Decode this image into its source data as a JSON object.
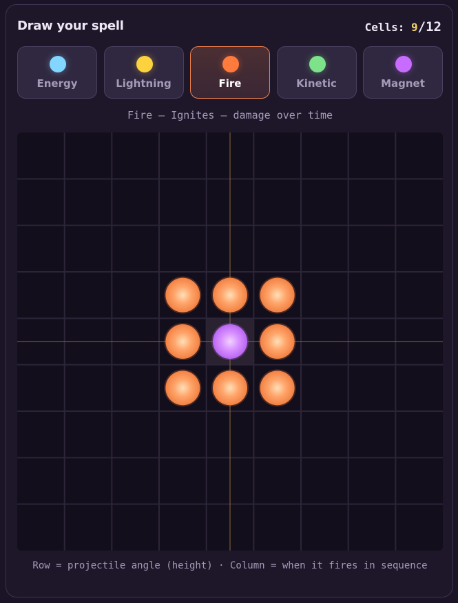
{
  "header": {
    "title": "Draw your spell",
    "cells_label": "Cells:",
    "cells_used": "9",
    "cells_max": "12",
    "cells_sep": "/"
  },
  "elements": [
    {
      "label": "Energy",
      "color": "#82d6ff",
      "icon": "energy-orb-icon",
      "active": false
    },
    {
      "label": "Lightning",
      "color": "#fdd23f",
      "icon": "lightning-orb-icon",
      "active": false
    },
    {
      "label": "Fire",
      "color": "#ff7a3d",
      "icon": "fire-orb-icon",
      "active": true
    },
    {
      "label": "Kinetic",
      "color": "#7de28a",
      "icon": "kinetic-orb-icon",
      "active": false
    },
    {
      "label": "Magnet",
      "color": "#c86bff",
      "icon": "magnet-orb-icon",
      "active": false
    }
  ],
  "description": "Fire — Ignites — damage over time",
  "grid": {
    "rows": 9,
    "cols": 9,
    "center": {
      "row": 4,
      "col": 4
    },
    "cells": [
      {
        "row": 3,
        "col": 3,
        "element": "fire"
      },
      {
        "row": 3,
        "col": 4,
        "element": "fire"
      },
      {
        "row": 3,
        "col": 5,
        "element": "fire"
      },
      {
        "row": 4,
        "col": 3,
        "element": "fire"
      },
      {
        "row": 4,
        "col": 4,
        "element": "magnet"
      },
      {
        "row": 4,
        "col": 5,
        "element": "fire"
      },
      {
        "row": 5,
        "col": 3,
        "element": "fire"
      },
      {
        "row": 5,
        "col": 4,
        "element": "fire"
      },
      {
        "row": 5,
        "col": 5,
        "element": "fire"
      }
    ],
    "colors": {
      "fire": "#ff7a3d",
      "magnet": "#c86bff",
      "crosshair": "#8a6b3f",
      "line": "#2c2538"
    }
  },
  "footer": "Row = projectile angle (height) · Column = when it fires in sequence"
}
